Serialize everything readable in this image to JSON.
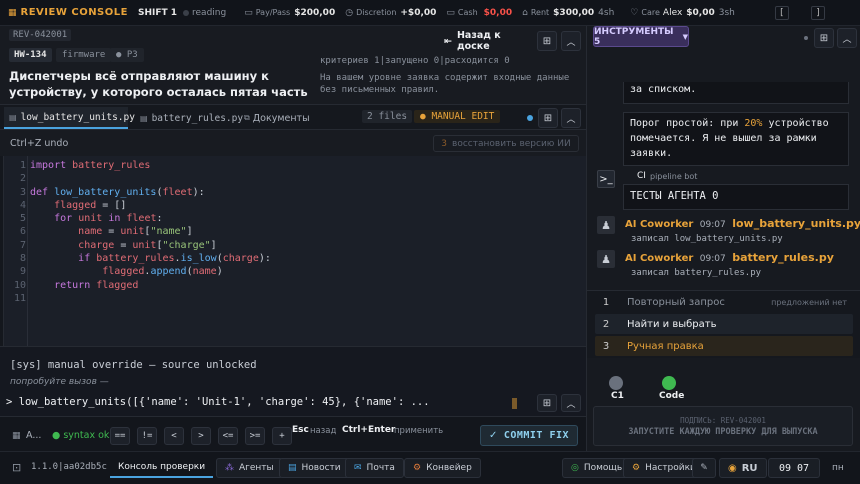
{
  "topbar": {
    "brand": "REVIEW CONSOLE",
    "shift": "SHIFT 1",
    "mode": "reading",
    "paypass_label": "Pay/Pass",
    "paypass_value": "$200,00",
    "discretion_label": "Discretion",
    "discretion_value": "+$0,00",
    "cash_label": "Cash",
    "cash_value": "$0,00",
    "rent_label": "Rent",
    "rent_value": "$300,00",
    "rent_due": "4sh",
    "care_label": "Care",
    "care_name": "Alex",
    "care_value": "$0,00",
    "care_due": "3sh",
    "key1": "[",
    "key2": "]"
  },
  "ticket": {
    "id": "REV-042001",
    "code": "HW-134",
    "category": "firmware",
    "priority": "P3",
    "back_label": "Назад к доске",
    "description": "Диспетчеры всё отправляют машину к устройству, у которого осталась пятая часть заряда. Пожалуйста,",
    "criteria_line": "критериев 1|запущено 0|расходится 0",
    "note": "На вашем уровне заявка содержит входные данные без письменных правил."
  },
  "editor": {
    "tabs": [
      "low_battery_units.py",
      "battery_rules.py",
      "Документы"
    ],
    "files_count": "2 files",
    "manual_edit": "MANUAL EDIT",
    "undo_hint": "Ctrl+Z undo",
    "restore_label": "восстановить версию ИИ",
    "restore_count": "3",
    "line_numbers": [
      "1",
      "2",
      "3",
      "4",
      "5",
      "6",
      "7",
      "8",
      "9",
      "10",
      "11"
    ]
  },
  "console": {
    "sys_line": "[sys] manual override — source unlocked",
    "hint": "попробуйте вызов —",
    "prompt": ">",
    "input_value": "low_battery_units([{'name': 'Unit-1', 'charge': 45}, {'name': ..."
  },
  "actionbar": {
    "autocomplete": "A...",
    "syntax": "syntax ok",
    "ops": [
      "==",
      "!=",
      "<",
      ">",
      "<=",
      ">=",
      "+"
    ],
    "esc_key": "Esc",
    "esc_label": "назад",
    "enter_key": "Ctrl+Enter",
    "enter_label": "применить",
    "commit": "COMMIT FIX"
  },
  "tools": {
    "label": "ИНСТРУМЕНТЫ 5"
  },
  "chat": {
    "msg1_tail": "за списком.",
    "msg2_pre": "Порог простой: при ",
    "msg2_pct": "20%",
    "msg2_post": " устройство помечается. Я не вышел за рамки заявки.",
    "pipeline_id": "CI",
    "pipeline_label": "pipeline bot",
    "tests_label": "ТЕСТЫ АГЕНТА 0",
    "entries": [
      {
        "author": "AI Coworker",
        "time": "09:07",
        "file": "low_battery_units.py",
        "action": "записал low_battery_units.py"
      },
      {
        "author": "AI Coworker",
        "time": "09:07",
        "file": "battery_rules.py",
        "action": "записал battery_rules.py"
      }
    ]
  },
  "steps": [
    {
      "num": "1",
      "label": "Повторный запрос",
      "note": "предложений нет"
    },
    {
      "num": "2",
      "label": "Найти и выбрать",
      "note": ""
    },
    {
      "num": "3",
      "label": "Ручная правка",
      "note": ""
    }
  ],
  "status_dots": [
    {
      "label": "C1",
      "color": "#6a717d"
    },
    {
      "label": "Code",
      "color": "#3fb950"
    }
  ],
  "signature": {
    "line1": "ПОДПИСЬ: REV-042001",
    "line2": "ЗАПУСТИТЕ КАЖДУЮ ПРОВЕРКУ ДЛЯ ВЫПУСКА"
  },
  "bottombar": {
    "version": "1.1.0|aa02db5c",
    "console_tab": "Консоль проверки",
    "agents": "Агенты",
    "news": "Новости",
    "mail": "Почта",
    "pipeline": "Конвейер",
    "help": "Помощь",
    "settings": "Настройки",
    "lang": "RU",
    "clock": "09 07",
    "day": "пн"
  },
  "colors": {
    "accent": "#e8a33a",
    "green": "#3fb950",
    "red": "#f85149",
    "purple": "#8a6ad8"
  }
}
